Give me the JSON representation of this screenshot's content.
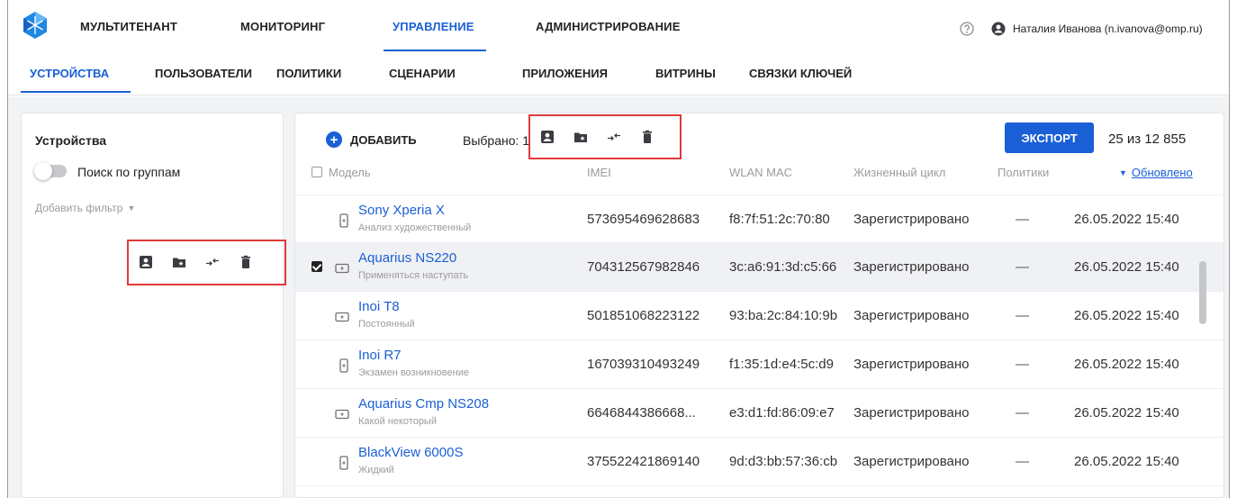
{
  "topnav": {
    "tabs": [
      "МУЛЬТИТЕНАНТ",
      "МОНИТОРИНГ",
      "УПРАВЛЕНИЕ",
      "АДМИНИСТРИРОВАНИЕ"
    ],
    "active": "УПРАВЛЕНИЕ",
    "user": "Наталия Иванова (n.ivanova@omp.ru)"
  },
  "subnav": {
    "tabs": [
      "УСТРОЙСТВА",
      "ПОЛЬЗОВАТЕЛИ",
      "ПОЛИТИКИ",
      "СЦЕНАРИИ",
      "ПРИЛОЖЕНИЯ",
      "ВИТРИНЫ",
      "СВЯЗКИ КЛЮЧЕЙ"
    ],
    "active": "УСТРОЙСТВА"
  },
  "left": {
    "title": "Устройства",
    "toggle_label": "Поиск по группам",
    "add_filter": "Добавить фильтр"
  },
  "toolbar": {
    "add_label": "ДОБАВИТЬ",
    "selected_label": "Выбрано: 1",
    "export_label": "ЭКСПОРТ",
    "count_label": "25 из 12 855"
  },
  "table": {
    "columns": {
      "model": "Модель",
      "imei": "IMEI",
      "wlan": "WLAN MAC",
      "lifecycle": "Жизненный цикл",
      "policies": "Политики",
      "updated": "Обновлено"
    },
    "rows": [
      {
        "name": "Sony Xperia X",
        "desc": "Анализ художественный",
        "imei": "573695469628683",
        "wlan": "f8:7f:51:2c:70:80",
        "lifecycle": "Зарегистрировано",
        "policies": "—",
        "updated": "26.05.2022 15:40",
        "selected": false,
        "device": "phone"
      },
      {
        "name": "Aquarius NS220",
        "desc": "Применяться наступать",
        "imei": "704312567982846",
        "wlan": "3c:a6:91:3d:c5:66",
        "lifecycle": "Зарегистрировано",
        "policies": "—",
        "updated": "26.05.2022 15:40",
        "selected": true,
        "device": "tablet"
      },
      {
        "name": "Inoi T8",
        "desc": "Постоянный",
        "imei": "501851068223122",
        "wlan": "93:ba:2c:84:10:9b",
        "lifecycle": "Зарегистрировано",
        "policies": "—",
        "updated": "26.05.2022 15:40",
        "selected": false,
        "device": "tablet"
      },
      {
        "name": "Inoi R7",
        "desc": "Экзамен возникновение",
        "imei": "167039310493249",
        "wlan": "f1:35:1d:e4:5c:d9",
        "lifecycle": "Зарегистрировано",
        "policies": "—",
        "updated": "26.05.2022 15:40",
        "selected": false,
        "device": "phone"
      },
      {
        "name": "Aquarius Cmp NS208",
        "desc": "Какой некоторый",
        "imei": "6646844386668...",
        "wlan": "e3:d1:fd:86:09:e7",
        "lifecycle": "Зарегистрировано",
        "policies": "—",
        "updated": "26.05.2022 15:40",
        "selected": false,
        "device": "tablet"
      },
      {
        "name": "BlackView 6000S",
        "desc": "Жидкий",
        "imei": "375522421869140",
        "wlan": "9d:d3:bb:57:36:cb",
        "lifecycle": "Зарегистрировано",
        "policies": "—",
        "updated": "26.05.2022 15:40",
        "selected": false,
        "device": "phone"
      }
    ]
  },
  "colors": {
    "accent": "#1a5fd6",
    "highlight": "#e03a3a"
  }
}
